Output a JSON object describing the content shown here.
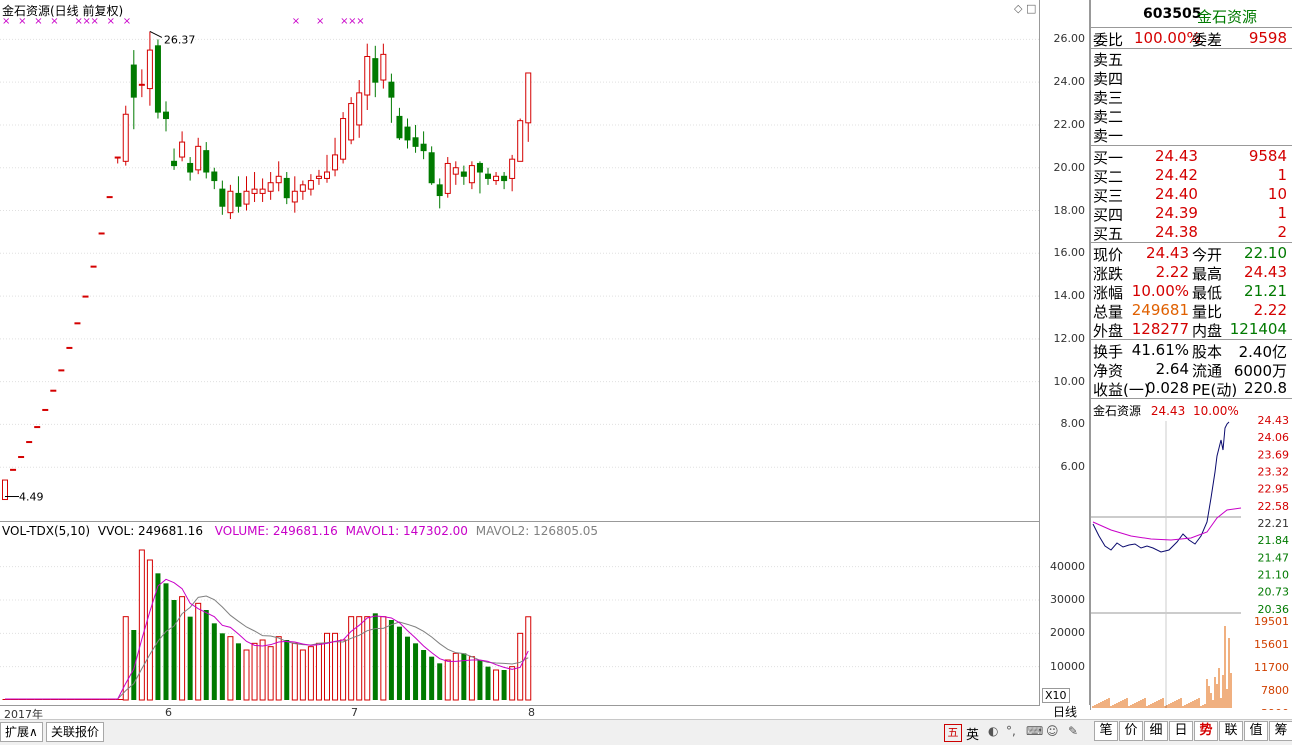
{
  "chart_header": {
    "title": "金石资源(日线 前复权)",
    "max_label": "26.37",
    "min_label": "4.49"
  },
  "price_axis": [
    "26.00",
    "24.00",
    "22.00",
    "20.00",
    "18.00",
    "16.00",
    "14.00",
    "12.00",
    "10.00",
    "8.00",
    "6.00"
  ],
  "volume_header": {
    "indicator": "VOL-TDX(5,10)",
    "vvol": "VVOL: 249681.16",
    "volume": "VOLUME: 249681.16",
    "mavol1": "MAVOL1: 147302.00",
    "mavol2": "MAVOL2: 126805.05"
  },
  "volume_axis": [
    "40000",
    "30000",
    "20000",
    "10000"
  ],
  "volume_unit": "X10",
  "date_axis": {
    "year": "2017年",
    "m6": "6",
    "m7": "7",
    "m8": "8"
  },
  "period_label": "日线",
  "status_tabs": [
    "扩展∧",
    "关联报价"
  ],
  "quote": {
    "code": "603505",
    "name": "金石资源",
    "weibi_label": "委比",
    "weibi_value": "100.00%",
    "weicha_label": "委差",
    "weicha_value": "9598",
    "sells": [
      {
        "label": "卖五",
        "price": "",
        "vol": ""
      },
      {
        "label": "卖四",
        "price": "",
        "vol": ""
      },
      {
        "label": "卖三",
        "price": "",
        "vol": ""
      },
      {
        "label": "卖二",
        "price": "",
        "vol": ""
      },
      {
        "label": "卖一",
        "price": "",
        "vol": ""
      }
    ],
    "buys": [
      {
        "label": "买一",
        "price": "24.43",
        "vol": "9584"
      },
      {
        "label": "买二",
        "price": "24.42",
        "vol": "1"
      },
      {
        "label": "买三",
        "price": "24.40",
        "vol": "10"
      },
      {
        "label": "买四",
        "price": "24.39",
        "vol": "1"
      },
      {
        "label": "买五",
        "price": "24.38",
        "vol": "2"
      }
    ],
    "stats1": [
      {
        "l1": "现价",
        "v1": "24.43",
        "l2": "今开",
        "v2": "22.10"
      },
      {
        "l1": "涨跌",
        "v1": "2.22",
        "l2": "最高",
        "v2": "24.43"
      },
      {
        "l1": "涨幅",
        "v1": "10.00%",
        "l2": "最低",
        "v2": "21.21"
      },
      {
        "l1": "总量",
        "v1": "249681",
        "l2": "量比",
        "v2": "2.22"
      },
      {
        "l1": "外盘",
        "v1": "128277",
        "l2": "内盘",
        "v2": "121404"
      }
    ],
    "stats2": [
      {
        "l1": "换手",
        "v1": "41.61%",
        "l2": "股本",
        "v2": "2.40亿"
      },
      {
        "l1": "净资",
        "v1": "2.64",
        "l2": "流通",
        "v2": "6000万"
      },
      {
        "l1": "收益(一)",
        "v1": "0.028",
        "l2": "PE(动)",
        "v2": "220.8"
      }
    ]
  },
  "mini_chart": {
    "name": "金石资源",
    "price": "24.43",
    "pct": "10.00%",
    "price_axis": [
      "24.43",
      "24.06",
      "23.69",
      "23.32",
      "22.95",
      "22.58",
      "22.21",
      "21.84",
      "21.47",
      "21.10",
      "20.73",
      "20.36"
    ],
    "vol_axis": [
      "19501",
      "15601",
      "11700",
      "7800",
      "3900"
    ]
  },
  "right_tabs": [
    "笔",
    "价",
    "细",
    "日",
    "势",
    "联",
    "值",
    "筹"
  ],
  "tray_icons": [
    "五",
    "英"
  ],
  "colors": {
    "up": "#d40000",
    "down": "#007a00",
    "ma1": "#c800c8",
    "ma2": "#808080"
  },
  "chart_data": {
    "type": "candlestick",
    "title": "金石资源(日线 前复权)",
    "candles": [
      {
        "o": 4.49,
        "c": 5.4,
        "h": 5.4,
        "l": 4.49
      },
      {
        "o": 5.9,
        "c": 5.9,
        "h": 5.9,
        "l": 5.9
      },
      {
        "o": 6.5,
        "c": 6.5,
        "h": 6.5,
        "l": 6.5
      },
      {
        "o": 7.2,
        "c": 7.2,
        "h": 7.2,
        "l": 7.2
      },
      {
        "o": 7.9,
        "c": 7.9,
        "h": 7.9,
        "l": 7.9
      },
      {
        "o": 8.7,
        "c": 8.7,
        "h": 8.7,
        "l": 8.7
      },
      {
        "o": 9.6,
        "c": 9.6,
        "h": 9.6,
        "l": 9.6
      },
      {
        "o": 10.55,
        "c": 10.55,
        "h": 10.55,
        "l": 10.55
      },
      {
        "o": 11.6,
        "c": 11.6,
        "h": 11.6,
        "l": 11.6
      },
      {
        "o": 12.75,
        "c": 12.75,
        "h": 12.75,
        "l": 12.75
      },
      {
        "o": 14.0,
        "c": 14.0,
        "h": 14.0,
        "l": 14.0
      },
      {
        "o": 15.4,
        "c": 15.4,
        "h": 15.4,
        "l": 15.4
      },
      {
        "o": 16.95,
        "c": 16.95,
        "h": 16.95,
        "l": 16.95
      },
      {
        "o": 18.65,
        "c": 18.65,
        "h": 18.65,
        "l": 18.65
      },
      {
        "o": 20.5,
        "c": 20.5,
        "h": 20.5,
        "l": 20.2
      },
      {
        "o": 20.3,
        "c": 22.5,
        "h": 22.9,
        "l": 20.1
      },
      {
        "o": 24.8,
        "c": 23.3,
        "h": 25.5,
        "l": 21.8
      },
      {
        "o": 23.9,
        "c": 23.9,
        "h": 24.6,
        "l": 23.3
      },
      {
        "o": 23.7,
        "c": 25.5,
        "h": 26.37,
        "l": 22.9
      },
      {
        "o": 25.7,
        "c": 22.6,
        "h": 26.0,
        "l": 22.3
      },
      {
        "o": 22.6,
        "c": 22.3,
        "h": 23.1,
        "l": 21.7
      },
      {
        "o": 20.3,
        "c": 20.1,
        "h": 20.9,
        "l": 19.9
      },
      {
        "o": 20.5,
        "c": 21.2,
        "h": 21.7,
        "l": 20.3
      },
      {
        "o": 20.2,
        "c": 19.8,
        "h": 20.5,
        "l": 19.4
      },
      {
        "o": 19.9,
        "c": 21.0,
        "h": 21.4,
        "l": 19.7
      },
      {
        "o": 20.8,
        "c": 19.8,
        "h": 21.2,
        "l": 19.5
      },
      {
        "o": 19.8,
        "c": 19.4,
        "h": 20.0,
        "l": 19.0
      },
      {
        "o": 19.0,
        "c": 18.2,
        "h": 19.4,
        "l": 17.8
      },
      {
        "o": 17.9,
        "c": 18.9,
        "h": 19.2,
        "l": 17.6
      },
      {
        "o": 18.8,
        "c": 18.2,
        "h": 19.6,
        "l": 17.9
      },
      {
        "o": 18.3,
        "c": 18.9,
        "h": 19.6,
        "l": 18.0
      },
      {
        "o": 18.8,
        "c": 19.0,
        "h": 19.8,
        "l": 18.4
      },
      {
        "o": 18.8,
        "c": 19.0,
        "h": 19.5,
        "l": 18.4
      },
      {
        "o": 18.9,
        "c": 19.3,
        "h": 19.8,
        "l": 18.5
      },
      {
        "o": 19.3,
        "c": 19.6,
        "h": 20.3,
        "l": 18.9
      },
      {
        "o": 19.5,
        "c": 18.6,
        "h": 19.8,
        "l": 18.3
      },
      {
        "o": 18.4,
        "c": 18.9,
        "h": 19.6,
        "l": 17.9
      },
      {
        "o": 18.9,
        "c": 19.2,
        "h": 19.4,
        "l": 18.5
      },
      {
        "o": 19.0,
        "c": 19.4,
        "h": 19.7,
        "l": 18.7
      },
      {
        "o": 19.5,
        "c": 19.6,
        "h": 19.9,
        "l": 19.2
      },
      {
        "o": 19.5,
        "c": 19.8,
        "h": 20.6,
        "l": 19.3
      },
      {
        "o": 19.9,
        "c": 20.6,
        "h": 21.4,
        "l": 19.6
      },
      {
        "o": 20.4,
        "c": 22.3,
        "h": 22.6,
        "l": 20.2
      },
      {
        "o": 21.3,
        "c": 23.0,
        "h": 23.3,
        "l": 21.1
      },
      {
        "o": 22.0,
        "c": 23.5,
        "h": 24.1,
        "l": 21.4
      },
      {
        "o": 23.4,
        "c": 25.2,
        "h": 25.8,
        "l": 22.7
      },
      {
        "o": 25.1,
        "c": 24.0,
        "h": 25.7,
        "l": 23.3
      },
      {
        "o": 24.1,
        "c": 25.3,
        "h": 25.8,
        "l": 23.7
      },
      {
        "o": 24.0,
        "c": 23.3,
        "h": 24.4,
        "l": 22.1
      },
      {
        "o": 22.4,
        "c": 21.4,
        "h": 22.8,
        "l": 21.3
      },
      {
        "o": 21.9,
        "c": 21.3,
        "h": 22.3,
        "l": 20.9
      },
      {
        "o": 21.4,
        "c": 21.0,
        "h": 22.0,
        "l": 20.7
      },
      {
        "o": 21.1,
        "c": 20.8,
        "h": 21.7,
        "l": 20.4
      },
      {
        "o": 20.7,
        "c": 19.3,
        "h": 21.0,
        "l": 19.2
      },
      {
        "o": 19.2,
        "c": 18.7,
        "h": 19.5,
        "l": 18.1
      },
      {
        "o": 18.8,
        "c": 20.2,
        "h": 20.5,
        "l": 18.6
      },
      {
        "o": 19.7,
        "c": 20.0,
        "h": 20.3,
        "l": 19.2
      },
      {
        "o": 19.8,
        "c": 19.6,
        "h": 20.1,
        "l": 19.2
      },
      {
        "o": 19.3,
        "c": 20.1,
        "h": 20.3,
        "l": 19.0
      },
      {
        "o": 20.2,
        "c": 19.8,
        "h": 20.3,
        "l": 18.8
      },
      {
        "o": 19.7,
        "c": 19.5,
        "h": 20.0,
        "l": 19.2
      },
      {
        "o": 19.4,
        "c": 19.6,
        "h": 19.8,
        "l": 19.2
      },
      {
        "o": 19.6,
        "c": 19.4,
        "h": 19.8,
        "l": 19.0
      },
      {
        "o": 19.5,
        "c": 20.4,
        "h": 20.6,
        "l": 18.9
      },
      {
        "o": 20.3,
        "c": 22.2,
        "h": 22.3,
        "l": 20.4
      },
      {
        "o": 22.1,
        "c": 24.43,
        "h": 24.43,
        "l": 21.21
      }
    ],
    "volume": [
      300,
      300,
      300,
      300,
      300,
      300,
      300,
      300,
      300,
      300,
      300,
      300,
      300,
      300,
      300,
      25000,
      21000,
      45000,
      42000,
      38000,
      35000,
      30000,
      31000,
      25000,
      29000,
      27000,
      23000,
      20000,
      19000,
      17000,
      15000,
      17000,
      18000,
      16000,
      19000,
      18000,
      17000,
      15000,
      16000,
      17000,
      20000,
      20000,
      18000,
      25000,
      25000,
      25000,
      26000,
      25000,
      24000,
      22000,
      19000,
      17000,
      15000,
      13000,
      11000,
      12000,
      14000,
      14000,
      13000,
      12000,
      10000,
      9000,
      9000,
      10000,
      20000,
      24968
    ],
    "mavol1": [
      300,
      300,
      300,
      300,
      300,
      300,
      300,
      300,
      300,
      300,
      300,
      300,
      300,
      300,
      300,
      5000,
      9300,
      18300,
      26600,
      34200,
      36200,
      35200,
      33400,
      29000,
      27400,
      26200,
      25000,
      22400,
      21800,
      19800,
      17600,
      16400,
      16200,
      16600,
      17400,
      17600,
      17400,
      16800,
      16400,
      16600,
      17000,
      17600,
      18000,
      20600,
      22400,
      24600,
      25200,
      25000,
      24600,
      23200,
      20800,
      18600,
      16200,
      14200,
      12400,
      11600,
      11600,
      11800,
      12000,
      12000,
      11600,
      10600,
      9800,
      9200,
      9800,
      14715
    ],
    "mavol2": [
      300,
      300,
      300,
      300,
      300,
      300,
      300,
      300,
      300,
      300,
      300,
      300,
      300,
      300,
      300,
      2800,
      4900,
      9400,
      13700,
      17600,
      20600,
      22200,
      25900,
      27800,
      30800,
      31200,
      30100,
      27900,
      25400,
      23600,
      21900,
      20700,
      19300,
      19200,
      18600,
      17500,
      16900,
      16600,
      16500,
      17000,
      17200,
      17500,
      17400,
      18500,
      19400,
      20800,
      21400,
      21500,
      22600,
      23400,
      22700,
      21900,
      20600,
      18900,
      16900,
      15200,
      14200,
      13900,
      13000,
      11900,
      11300,
      11100,
      11000,
      10800,
      11300,
      12680
    ],
    "markers_top": [
      0,
      2,
      4,
      6,
      9,
      10,
      11,
      13,
      15,
      36,
      39,
      42,
      43,
      44
    ],
    "ylim": [
      4,
      27
    ],
    "vol_ylim": [
      0,
      48000
    ]
  }
}
